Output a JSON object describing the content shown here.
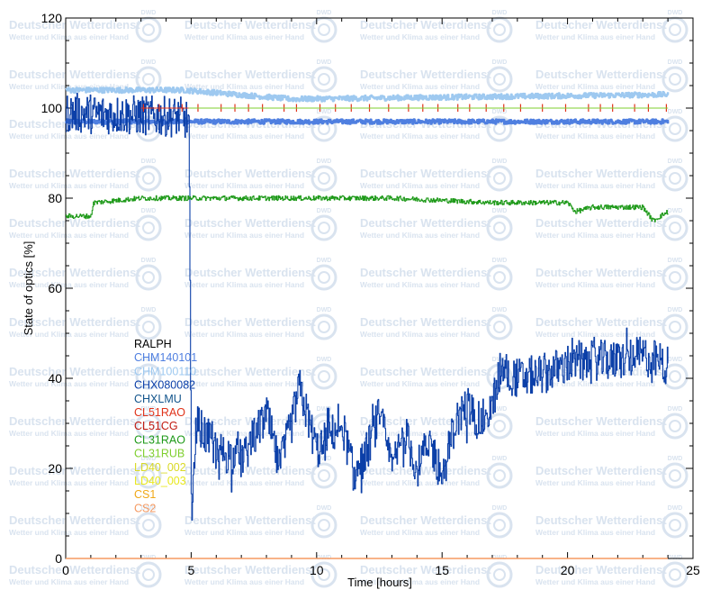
{
  "watermark": {
    "title": "Deutscher Wetterdienst",
    "subtitle": "Wetter und Klima aus einer Hand",
    "logo": "DWD"
  },
  "chart_data": {
    "type": "line",
    "title": "",
    "xlabel": "Time [hours]",
    "ylabel": "State of optics [%]",
    "xlim": [
      0,
      25
    ],
    "ylim": [
      0,
      120
    ],
    "xticks": [
      0,
      5,
      10,
      15,
      20,
      25
    ],
    "yticks": [
      0,
      20,
      40,
      60,
      80,
      100,
      120
    ],
    "grid": false,
    "legend_position": "left, inside plot",
    "legend": [
      {
        "name": "RALPH",
        "color": "#000000"
      },
      {
        "name": "CHM140101",
        "color": "#4f7fe0"
      },
      {
        "name": "CHM100110",
        "color": "#9ec9f0"
      },
      {
        "name": "CHX080082",
        "color": "#0b3fa8"
      },
      {
        "name": "CHXLMU",
        "color": "#13558c"
      },
      {
        "name": "CL51RAO",
        "color": "#e0331a"
      },
      {
        "name": "CL51CG",
        "color": "#c21a10"
      },
      {
        "name": "CL31RAO",
        "color": "#1f9a1a"
      },
      {
        "name": "CL31RUB",
        "color": "#7fcf2f"
      },
      {
        "name": "LD40_002",
        "color": "#d9d926"
      },
      {
        "name": "LD40_003",
        "color": "#e8e820"
      },
      {
        "name": "CS1",
        "color": "#f0a818"
      },
      {
        "name": "CS2",
        "color": "#f59a62"
      }
    ],
    "series": [
      {
        "name": "CHM140101",
        "color": "#4f7fe0",
        "description_points": [
          [
            0,
            97
          ],
          [
            5,
            97
          ],
          [
            10,
            97
          ],
          [
            15,
            97
          ],
          [
            20,
            97
          ],
          [
            24,
            97
          ]
        ]
      },
      {
        "name": "CHM100110",
        "color": "#9ec9f0",
        "description_points": [
          [
            0,
            104
          ],
          [
            4.7,
            104
          ],
          [
            9,
            102
          ],
          [
            24,
            103
          ]
        ]
      },
      {
        "name": "CHX080082",
        "color": "#0b3fa8",
        "description_points": [
          [
            0,
            99
          ],
          [
            4.6,
            98
          ],
          [
            4.9,
            97
          ],
          [
            4.95,
            60
          ],
          [
            5,
            10
          ],
          [
            5.2,
            30
          ],
          [
            6,
            24
          ],
          [
            7,
            22
          ],
          [
            8,
            32
          ],
          [
            8.5,
            20
          ],
          [
            9,
            30
          ],
          [
            9.3,
            38
          ],
          [
            10,
            24
          ],
          [
            11,
            30
          ],
          [
            11.5,
            18
          ],
          [
            12,
            24
          ],
          [
            12.5,
            32
          ],
          [
            13,
            20
          ],
          [
            13.5,
            28
          ],
          [
            14,
            20
          ],
          [
            14.5,
            26
          ],
          [
            15,
            18
          ],
          [
            15.5,
            30
          ],
          [
            16,
            34
          ],
          [
            16.5,
            30
          ],
          [
            17,
            34
          ],
          [
            17.3,
            42
          ],
          [
            18,
            40
          ],
          [
            19,
            41
          ],
          [
            20,
            43
          ],
          [
            21,
            44
          ],
          [
            22,
            44
          ],
          [
            23,
            45
          ],
          [
            24,
            43
          ]
        ]
      },
      {
        "name": "CL51RAO",
        "color": "#e0331a",
        "description_points": [
          [
            3,
            100
          ],
          [
            24,
            100
          ]
        ]
      },
      {
        "name": "CL31RAO",
        "color": "#1f9a1a",
        "description_points": [
          [
            0,
            76
          ],
          [
            1,
            76
          ],
          [
            1.1,
            79
          ],
          [
            3,
            80
          ],
          [
            8,
            80
          ],
          [
            13,
            80
          ],
          [
            17,
            79
          ],
          [
            20,
            79
          ],
          [
            20.3,
            77
          ],
          [
            21,
            78
          ],
          [
            23,
            78
          ],
          [
            23.4,
            75
          ],
          [
            24,
            77
          ]
        ]
      },
      {
        "name": "CL31RUB",
        "color": "#7fcf2f",
        "description_points": [
          [
            4.9,
            100
          ],
          [
            24,
            100
          ]
        ]
      },
      {
        "name": "CS2",
        "color": "#f59a62",
        "description_points": [
          [
            0,
            0
          ],
          [
            24,
            0
          ]
        ]
      }
    ]
  }
}
